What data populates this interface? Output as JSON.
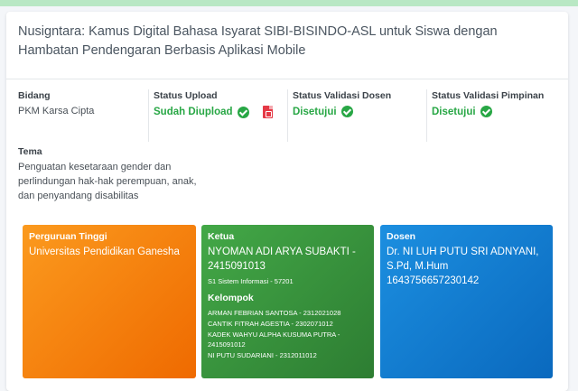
{
  "title": "Nusigntara: Kamus Digital Bahasa Isyarat SIBI-BISINDO-ASL untuk Siswa dengan Hambatan Pendengaran Berbasis Aplikasi Mobile",
  "bidang": {
    "label": "Bidang",
    "value": "PKM Karsa Cipta"
  },
  "status_upload": {
    "label": "Status Upload",
    "value": "Sudah Diupload"
  },
  "status_dosen": {
    "label": "Status Validasi Dosen",
    "value": "Disetujui"
  },
  "status_pimpinan": {
    "label": "Status Validasi Pimpinan",
    "value": "Disetujui"
  },
  "tema": {
    "label": "Tema",
    "value": "Penguatan kesetaraan gender dan perlindungan hak-hak perempuan, anak, dan penyandang disabilitas"
  },
  "perguruan": {
    "label": "Perguruan Tinggi",
    "value": "Universitas Pendidikan Ganesha"
  },
  "ketua": {
    "label": "Ketua",
    "name": "NYOMAN ADI ARYA SUBAKTI - 2415091013",
    "prodi": "S1 Sistem Informasi - 57201"
  },
  "kelompok": {
    "label": "Kelompok",
    "members": [
      "ARMAN FEBRIAN SANTOSA - 2312021028",
      "CANTIK FITRAH AGESTIA - 2302071012",
      "KADEK WAHYU ALPHA KUSUMA PUTRA - 2415091012",
      "NI PUTU SUDARIANI - 2312011012"
    ]
  },
  "dosen": {
    "label": "Dosen",
    "name": "Dr. NI LUH PUTU SRI ADNYANI, S.Pd, M.Hum",
    "id": "1643756657230142"
  },
  "colors": {
    "success": "#28a745",
    "orange": "#f57c00",
    "green": "#388e3c",
    "blue": "#1479d1",
    "pdf": "#e53946"
  },
  "icons": [
    "check-circle-icon",
    "pdf-icon"
  ]
}
